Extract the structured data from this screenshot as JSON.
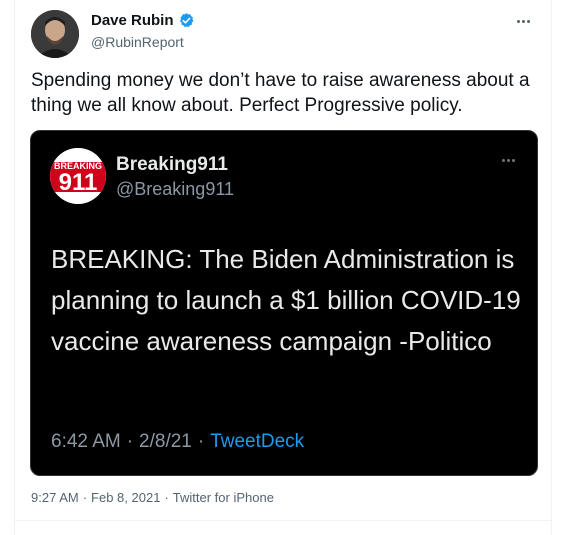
{
  "author": {
    "display_name": "Dave Rubin",
    "handle": "@RubinReport",
    "verified": true,
    "verified_color": "#1d9bf0"
  },
  "tweet": {
    "text": "Spending money we don’t have to raise awareness about a thing we all know about. Perfect Progressive policy."
  },
  "quoted": {
    "logo_text_top": "BREAKING",
    "logo_text_main": "911",
    "display_name": "Breaking911",
    "handle": "@Breaking911",
    "text": "BREAKING: The Biden Administration is planning to launch a $1 billion COVID-19 vaccine awareness campaign -Politico",
    "time": "6:42 AM",
    "separator_1": "·",
    "date": "2/8/21",
    "separator_2": "·",
    "source": "TweetDeck",
    "source_color": "#1d9bf0"
  },
  "meta": {
    "time": "9:27 AM",
    "separator_1": "·",
    "date": "Feb 8, 2021",
    "separator_2": "·",
    "client": "Twitter for iPhone"
  },
  "icons": {
    "more": "more-horizontal-icon",
    "verified": "verified-badge-icon"
  }
}
